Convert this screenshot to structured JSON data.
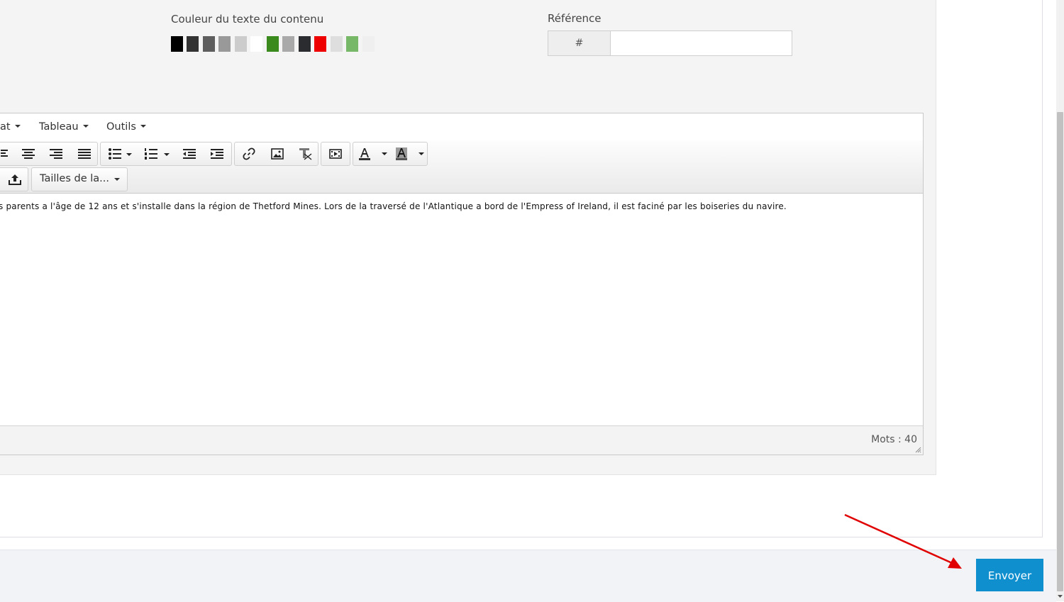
{
  "form": {
    "content_color_label": "Couleur du texte du contenu",
    "content_colors": [
      "#000000",
      "#333333",
      "#5e5e5e",
      "#999999",
      "#cccccc",
      "#ffffff",
      "#3a8a1e",
      "#a9a9a9",
      "#2a2c30",
      "#ee0000",
      "#dedede",
      "#77b868",
      "#efefef"
    ],
    "reference_label": "Référence",
    "reference_prefix": "#",
    "reference_value": ""
  },
  "editor": {
    "menu": [
      "at",
      "Tableau",
      "Outils"
    ],
    "font_size_select": "Tailles de la...",
    "toolbar_icons": [
      "align-left-icon",
      "align-center-icon",
      "align-right-icon",
      "align-justify-icon",
      "bullet-list-icon",
      "numbered-list-icon",
      "outdent-icon",
      "indent-icon",
      "link-icon",
      "image-icon",
      "clear-format-icon",
      "media-icon",
      "text-color-icon",
      "background-color-icon",
      "upload-icon"
    ],
    "content_text": "s parents a l'âge de 12 ans et s'installe dans la région de Thetford Mines. Lors de la traversé de l'Atlantique a bord de l'Empress of Ireland, il est faciné par les boiseries du navire.",
    "word_count": "Mots : 40"
  },
  "footer": {
    "submit_label": "Envoyer"
  },
  "colors": {
    "accent": "#108fcf",
    "arrow": "#e00000"
  }
}
